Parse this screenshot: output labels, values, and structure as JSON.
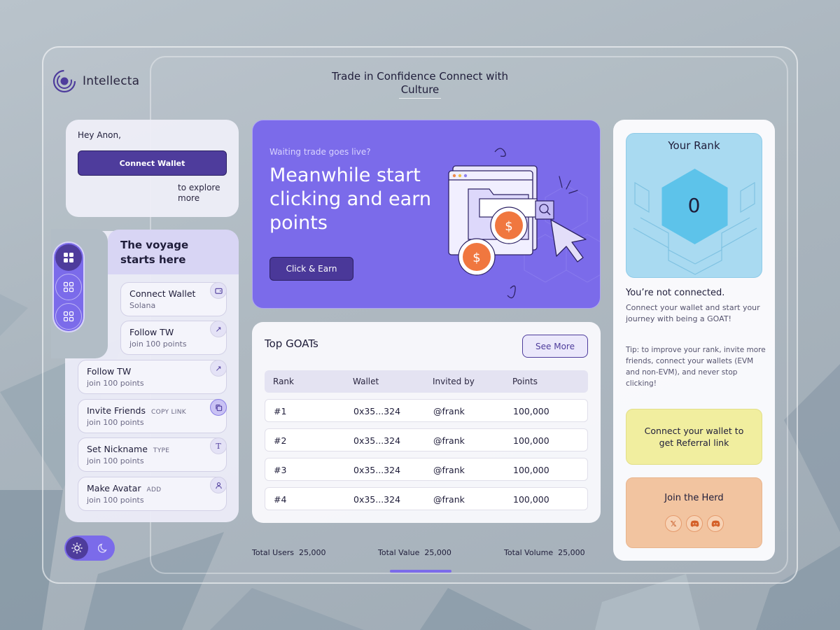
{
  "app": {
    "name": "Intellecta",
    "tagline": "Trade in Confidence Connect with Culture"
  },
  "greeting": {
    "text": "Hey Anon,",
    "connect_label": "Connect Wallet",
    "explore_text": "to explore more"
  },
  "sidebar": {
    "icons": [
      "grid-filled-icon",
      "grid-outline-icon",
      "grid-outline-icon"
    ]
  },
  "voyage": {
    "title": "The voyage starts here",
    "tasks": [
      {
        "title": "Connect Wallet",
        "tag": "",
        "sub": "Solana",
        "icon": "wallet-icon"
      },
      {
        "title": "Follow TW",
        "tag": "",
        "sub": "join 100 points",
        "icon": "arrow-up-right-icon"
      },
      {
        "title": "Follow TW",
        "tag": "",
        "sub": "join 100 points",
        "icon": "arrow-up-right-icon"
      },
      {
        "title": "Invite Friends",
        "tag": "COPY LINK",
        "sub": "join 100 points",
        "icon": "copy-icon"
      },
      {
        "title": "Set Nickname",
        "tag": "TYPE",
        "sub": "join 100 points",
        "icon": "text-icon"
      },
      {
        "title": "Make Avatar",
        "tag": "ADD",
        "sub": "join 100 points",
        "icon": "user-icon"
      }
    ]
  },
  "theme": {
    "active": "light"
  },
  "hero": {
    "kicker": "Waiting trade goes live?",
    "title": "Meanwhile start clicking and earn points",
    "button": "Click & Earn"
  },
  "goats": {
    "title": "Top GOATs",
    "see_more": "See More",
    "columns": [
      "Rank",
      "Wallet",
      "Invited by",
      "Points"
    ],
    "rows": [
      [
        "#1",
        "0x35...324",
        "@frank",
        "100,000"
      ],
      [
        "#2",
        "0x35...324",
        "@frank",
        "100,000"
      ],
      [
        "#3",
        "0x35...324",
        "@frank",
        "100,000"
      ],
      [
        "#4",
        "0x35...324",
        "@frank",
        "100,000"
      ]
    ]
  },
  "stats": [
    {
      "label": "Total Users",
      "value": "25,000"
    },
    {
      "label": "Total Value",
      "value": "25,000"
    },
    {
      "label": "Total Volume",
      "value": "25,000"
    }
  ],
  "rank": {
    "title": "Your Rank",
    "value": "0",
    "status": "You’re not connected.",
    "desc": "Connect your wallet and start your journey with being a GOAT!",
    "tip": "Tip: to improve your rank, invite more friends, connect your wallets (EVM and non-EVM), and never stop clicking!",
    "referral": "Connect your wallet to get Referral link",
    "herd_title": "Join the Herd",
    "socials": [
      "x-icon",
      "discord-icon",
      "discord-icon"
    ]
  },
  "colors": {
    "accent": "#7b6bea",
    "accent_dark": "#4e3c9c",
    "rank_bg": "#a9daf1",
    "referral_bg": "#f1ee9f",
    "herd_bg": "#f2c4a0"
  }
}
